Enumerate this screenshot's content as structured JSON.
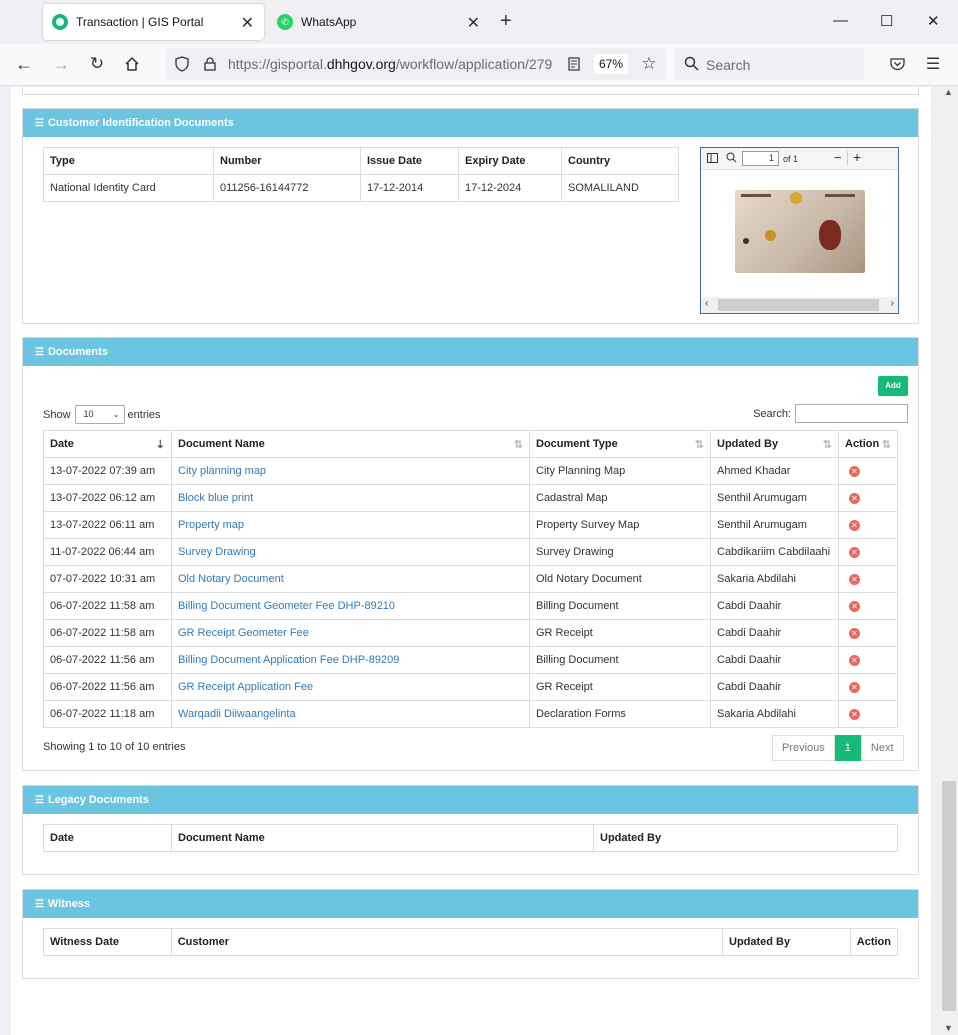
{
  "browser": {
    "tabs": [
      {
        "title": "Transaction | GIS Portal",
        "active": true,
        "favicon": "gis-portal-icon"
      },
      {
        "title": "WhatsApp",
        "active": false,
        "favicon": "whatsapp-icon"
      }
    ],
    "url_prefix": "https://gisportal.",
    "url_domain": "dhhgov.org",
    "url_path": "/workflow/application/279",
    "zoom": "67%",
    "search_placeholder": "Search"
  },
  "customer_id_docs": {
    "title": "Customer Identification Documents",
    "columns": [
      "Type",
      "Number",
      "Issue Date",
      "Expiry Date",
      "Country"
    ],
    "rows": [
      [
        "National Identity Card",
        "011256-16144772",
        "17-12-2014",
        "17-12-2024",
        "SOMALILAND"
      ]
    ],
    "viewer": {
      "page": "1",
      "of": "of 1"
    }
  },
  "documents": {
    "title": "Documents",
    "add_label": "Add",
    "show_label": "Show",
    "entries_value": "10",
    "entries_label": "entries",
    "search_label": "Search:",
    "columns": [
      "Date",
      "Document Name",
      "Document Type",
      "Updated By",
      "Action"
    ],
    "rows": [
      [
        "13-07-2022 07:39 am",
        "City planning map",
        "City Planning Map",
        "Ahmed Khadar"
      ],
      [
        "13-07-2022 06:12 am",
        "Block blue print",
        "Cadastral Map",
        "Senthil Arumugam"
      ],
      [
        "13-07-2022 06:11 am",
        "Property map",
        "Property Survey Map",
        "Senthil Arumugam"
      ],
      [
        "11-07-2022 06:44 am",
        "Survey Drawing",
        "Survey Drawing",
        "Cabdikariim Cabdilaahi"
      ],
      [
        "07-07-2022 10:31 am",
        "Old Notary Document",
        "Old Notary Document",
        "Sakaria Abdilahi"
      ],
      [
        "06-07-2022 11:58 am",
        "Billing Document Geometer Fee DHP-89210",
        "Billing Document",
        "Cabdi Daahir"
      ],
      [
        "06-07-2022 11:58 am",
        "GR Receipt Geometer Fee",
        "GR Receipt",
        "Cabdi Daahir"
      ],
      [
        "06-07-2022 11:56 am",
        "Billing Document Application Fee DHP-89209",
        "Billing Document",
        "Cabdi Daahir"
      ],
      [
        "06-07-2022 11:56 am",
        "GR Receipt Application Fee",
        "GR Receipt",
        "Cabdi Daahir"
      ],
      [
        "06-07-2022 11:18 am",
        "Warqadii Diiwaangelinta",
        "Declaration Forms",
        "Sakaria Abdilahi"
      ]
    ],
    "info": "Showing 1 to 10 of 10 entries",
    "pager": {
      "prev": "Previous",
      "page": "1",
      "next": "Next"
    }
  },
  "legacy": {
    "title": "Legacy Documents",
    "columns": [
      "Date",
      "Document Name",
      "Updated By"
    ]
  },
  "witness": {
    "title": "Witness",
    "columns": [
      "Witness Date",
      "Customer",
      "Updated By",
      "Action"
    ]
  },
  "colors": {
    "panel_header": "#6bc5e0",
    "accent_green": "#17b978",
    "link": "#337ab7",
    "delete": "#e86a5f"
  }
}
